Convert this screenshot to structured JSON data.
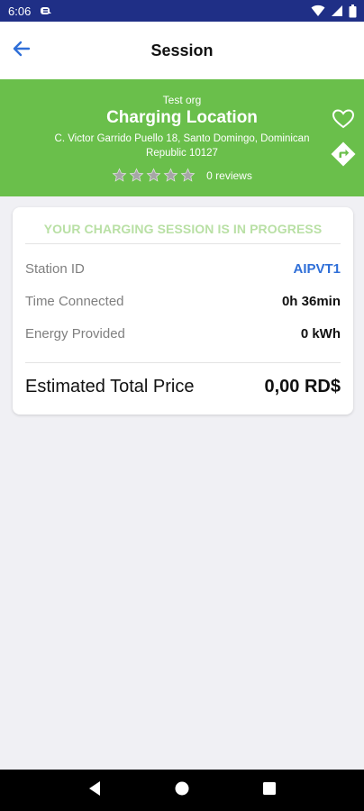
{
  "status_bar": {
    "time": "6:06",
    "icons": [
      "notification-icon",
      "wifi-icon",
      "signal-icon",
      "battery-icon"
    ]
  },
  "app_bar": {
    "title": "Session",
    "back_icon": "arrow-left-icon"
  },
  "location": {
    "org": "Test org",
    "title": "Charging Location",
    "address": "C. Victor Garrido Puello 18, Santo Domingo, Dominican Republic 10127",
    "rating": 0,
    "max_rating": 5,
    "reviews_label": "0 reviews",
    "favorite_icon": "heart-outline-icon",
    "directions_icon": "directions-icon"
  },
  "session": {
    "status": "YOUR CHARGING SESSION IS IN PROGRESS",
    "rows": [
      {
        "label": "Station ID",
        "value": "AIPVT1"
      },
      {
        "label": "Time Connected",
        "value": "0h 36min"
      },
      {
        "label": "Energy Provided",
        "value": "0 kWh"
      }
    ],
    "total_label": "Estimated Total Price",
    "total_value": "0,00 RD$"
  },
  "colors": {
    "status_bar": "#1f2f86",
    "header_green": "#6abf4b",
    "status_text": "#b9e0a5",
    "link_blue": "#2f6fd8",
    "back_arrow": "#2f6fd8"
  },
  "nav_bar": {
    "icons": [
      "back-triangle-icon",
      "home-circle-icon",
      "recents-square-icon"
    ]
  }
}
